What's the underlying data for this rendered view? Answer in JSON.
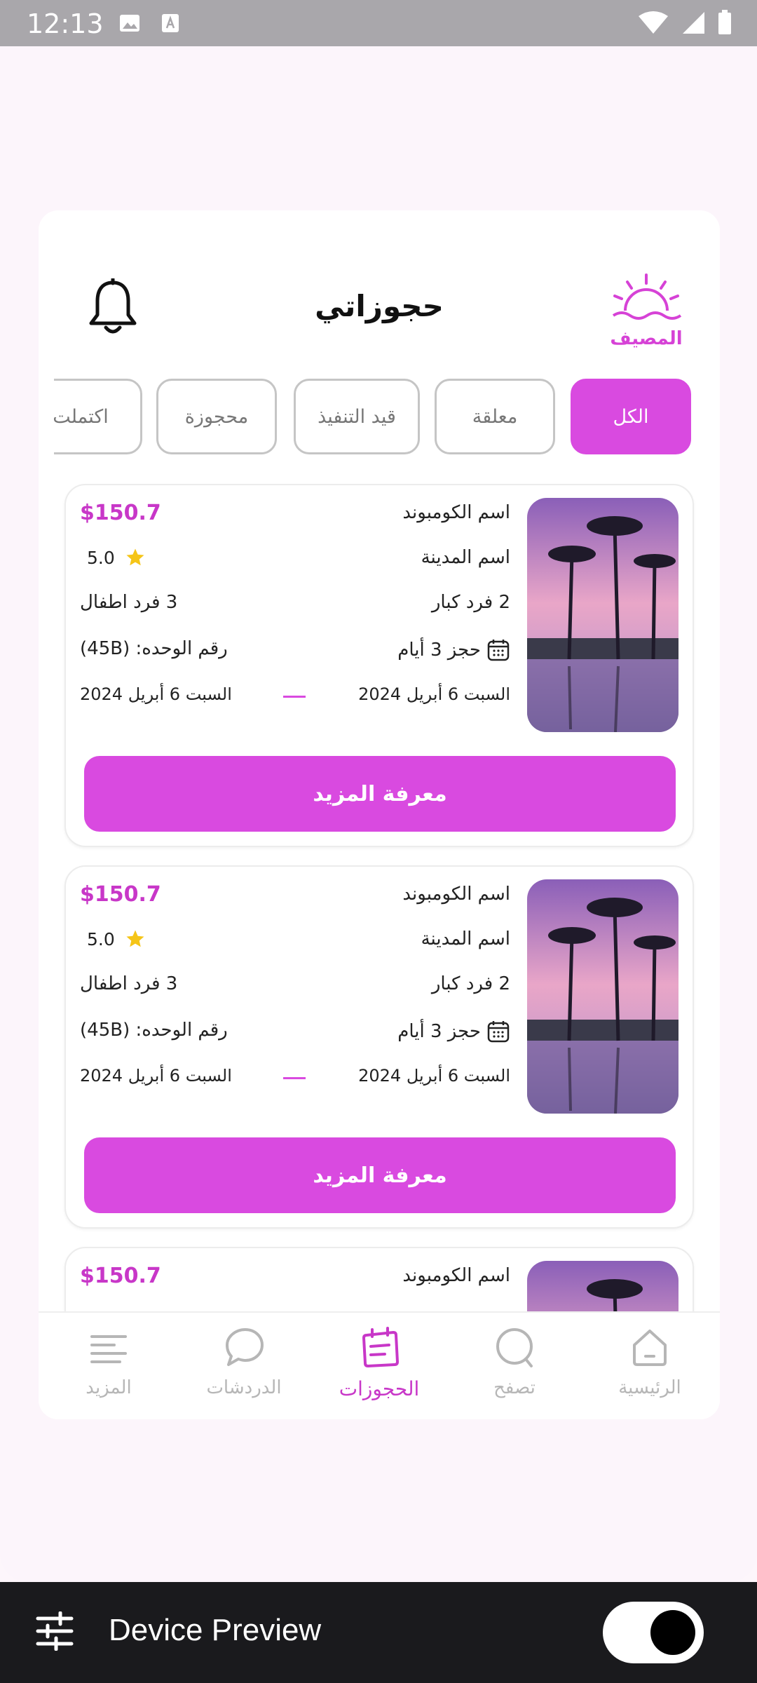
{
  "status_bar": {
    "time": "12:13"
  },
  "header": {
    "title": "حجوزاتي",
    "logo_text": "المصيف"
  },
  "tabs": [
    {
      "label": "الكل",
      "active": true
    },
    {
      "label": "معلقة",
      "active": false
    },
    {
      "label": "قيد التنفيذ",
      "active": false
    },
    {
      "label": "محجوزة",
      "active": false
    },
    {
      "label": "اكتملت",
      "active": false
    }
  ],
  "bookings": [
    {
      "price": "$150.7",
      "compound_name": "اسم الكومبوند",
      "city_name": "اسم المدينة",
      "rating": "5.0",
      "adults": "2 فرد كبار",
      "children": "3 فرد اطفال",
      "duration": "حجز 3 أيام",
      "unit_number": "رقم الوحده: (45B)",
      "start_date": "السبت 6 أبريل 2024",
      "end_date": "السبت 6 أبريل 2024",
      "cta_label": "معرفة المزيد"
    },
    {
      "price": "$150.7",
      "compound_name": "اسم الكومبوند",
      "city_name": "اسم المدينة",
      "rating": "5.0",
      "adults": "2 فرد كبار",
      "children": "3 فرد اطفال",
      "duration": "حجز 3 أيام",
      "unit_number": "رقم الوحده: (45B)",
      "start_date": "السبت 6 أبريل 2024",
      "end_date": "السبت 6 أبريل 2024",
      "cta_label": "معرفة المزيد"
    },
    {
      "price": "$150.7",
      "compound_name": "اسم الكومبوند"
    }
  ],
  "bottom_nav": [
    {
      "label": "الرئيسية",
      "icon": "home-icon",
      "active": false
    },
    {
      "label": "تصفح",
      "icon": "search-icon",
      "active": false
    },
    {
      "label": "الحجوزات",
      "icon": "bookings-icon",
      "active": true
    },
    {
      "label": "الدردشات",
      "icon": "chat-icon",
      "active": false
    },
    {
      "label": "المزيد",
      "icon": "menu-icon",
      "active": false
    }
  ],
  "device_preview": {
    "label": "Device Preview",
    "toggle_on": true
  },
  "colors": {
    "accent": "#d94ae0",
    "price": "#c837c8",
    "star": "#f5c518"
  }
}
